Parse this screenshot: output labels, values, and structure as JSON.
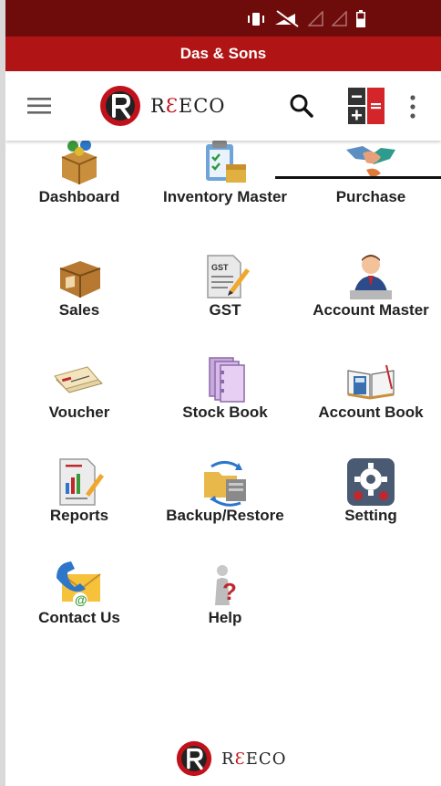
{
  "app": {
    "title": "Das & Sons",
    "brand_prefix": "R",
    "brand_rest": "ECO",
    "brand_accent_letter": "Ɛ"
  },
  "colors": {
    "status_bar": "#6e0c0c",
    "title_bar": "#b01414",
    "brand_red": "#c1121b"
  },
  "toolbar": {
    "menu_icon": "hamburger-menu-icon",
    "search_icon": "search-icon",
    "calculator_icon": "calculator-icon",
    "more_icon": "more-vert-icon"
  },
  "tiles": [
    {
      "id": "dashboard",
      "label": "Dashboard",
      "icon": "dashboard-box-icon"
    },
    {
      "id": "inventory",
      "label": "Inventory Master",
      "icon": "inventory-clipboard-icon"
    },
    {
      "id": "purchase",
      "label": "Purchase",
      "icon": "handshake-icon"
    },
    {
      "id": "sales",
      "label": "Sales",
      "icon": "sales-box-icon"
    },
    {
      "id": "gst",
      "label": "GST",
      "icon": "gst-document-icon"
    },
    {
      "id": "account-master",
      "label": "Account Master",
      "icon": "accountant-person-icon"
    },
    {
      "id": "voucher",
      "label": "Voucher",
      "icon": "voucher-cheque-icon"
    },
    {
      "id": "stock-book",
      "label": "Stock Book",
      "icon": "stock-book-binder-icon"
    },
    {
      "id": "account-book",
      "label": "Account Book",
      "icon": "account-book-calculator-icon"
    },
    {
      "id": "reports",
      "label": "Reports",
      "icon": "report-chart-icon"
    },
    {
      "id": "backup",
      "label": "Backup/Restore",
      "icon": "backup-restore-icon"
    },
    {
      "id": "setting",
      "label": "Setting",
      "icon": "settings-gear-icon"
    },
    {
      "id": "contact",
      "label": "Contact Us",
      "icon": "contact-phone-mail-icon"
    },
    {
      "id": "help",
      "label": "Help",
      "icon": "help-person-icon"
    }
  ]
}
